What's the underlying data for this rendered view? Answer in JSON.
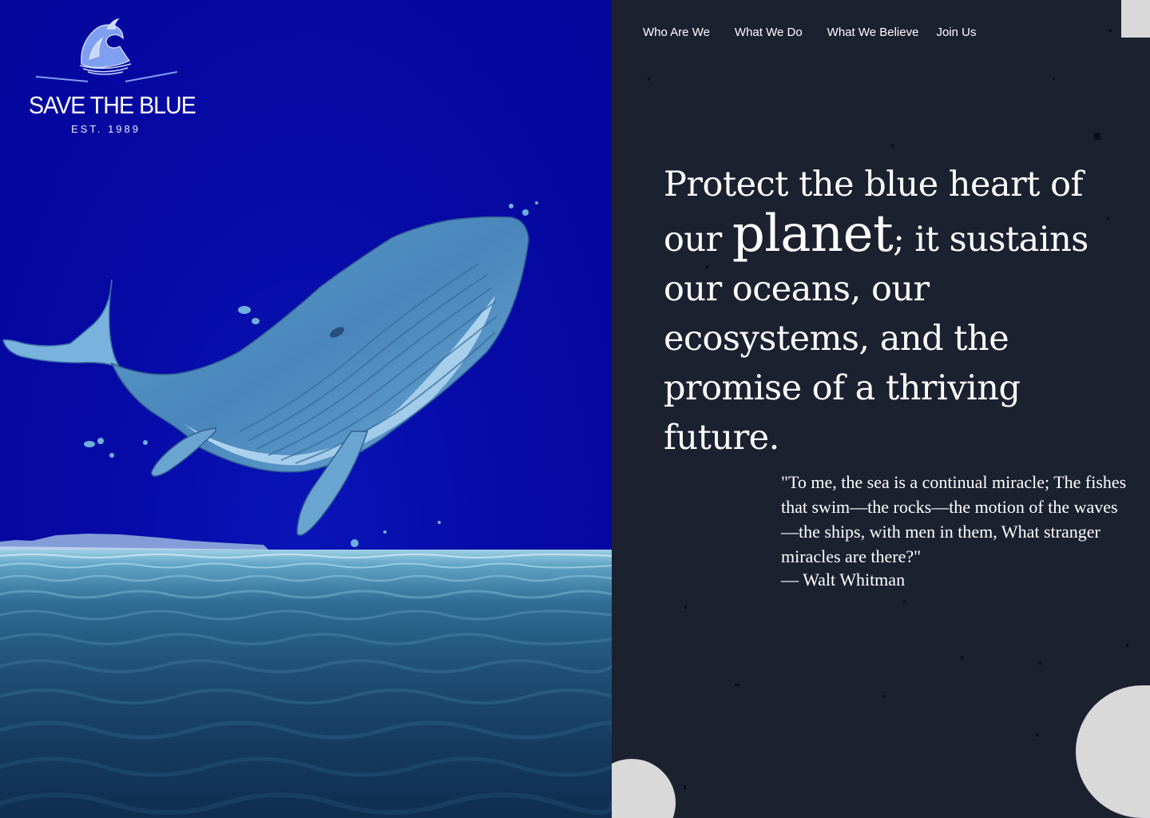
{
  "brand": {
    "name": "SAVE THE BLUE",
    "established": "EST. 1989",
    "icon": "wave-logo-icon"
  },
  "nav": {
    "items": [
      {
        "label": "Who Are We"
      },
      {
        "label": "What We Do"
      },
      {
        "label": "What We Believe"
      },
      {
        "label": "Join Us"
      }
    ]
  },
  "hero": {
    "headline_part1": "Protect the blue heart of our ",
    "headline_emphasis": "planet",
    "headline_part2": "; it sustains our oceans, our ecosystems, and the promise of a thriving future."
  },
  "quote": {
    "text": "\"To me, the sea is a continual miracle; The fishes that swim—the rocks—the motion of the waves—the ships, with men in them, What stranger miracles are there?\"",
    "author": "— Walt Whitman"
  },
  "colors": {
    "left_background": "#050aa2",
    "right_background": "#1c2130",
    "accent_shape": "#d9d9d9",
    "text": "#ffffff"
  }
}
